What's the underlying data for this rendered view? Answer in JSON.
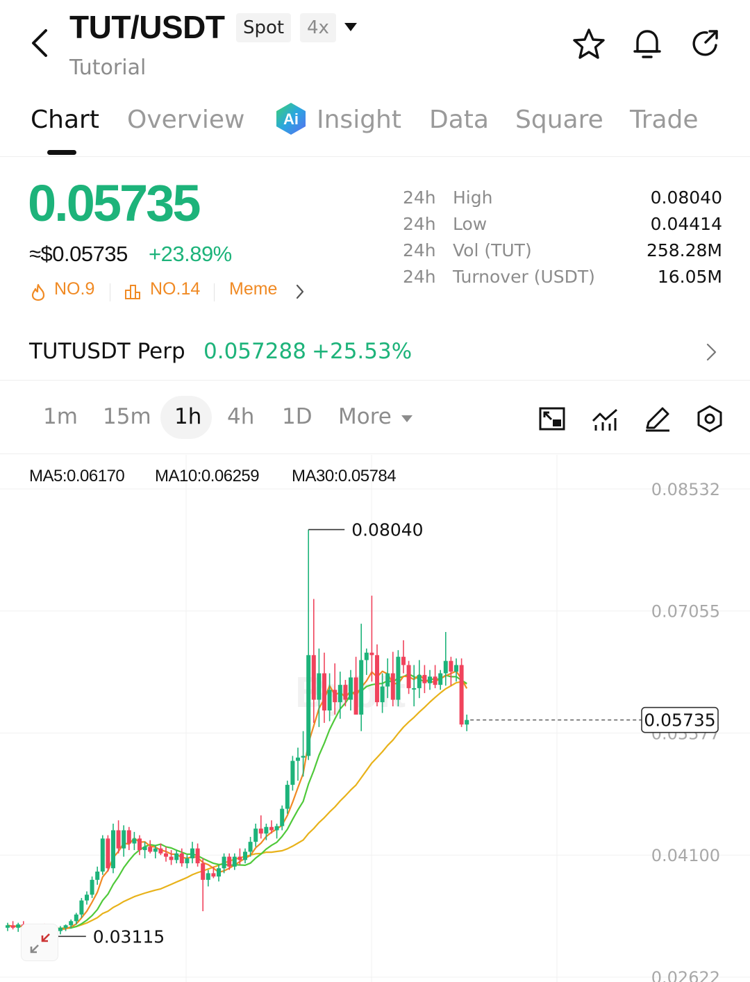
{
  "header": {
    "pair": "TUT/USDT",
    "market_type": "Spot",
    "leverage": "4x",
    "subtitle": "Tutorial",
    "icons": [
      "back-arrow-icon",
      "star-icon",
      "bell-icon",
      "share-icon"
    ]
  },
  "tabs": [
    {
      "label": "Chart",
      "active": true
    },
    {
      "label": "Overview",
      "active": false
    },
    {
      "label": "Insight",
      "active": false,
      "icon": "ai-icon"
    },
    {
      "label": "Data",
      "active": false
    },
    {
      "label": "Square",
      "active": false
    },
    {
      "label": "Trade",
      "active": false
    }
  ],
  "price": {
    "last": "0.05735",
    "fiat": "≈$0.05735",
    "change": "+23.89%",
    "ranks": [
      {
        "icon": "flame-icon",
        "label": "NO.9"
      },
      {
        "icon": "ranking-icon",
        "label": "NO.14"
      }
    ],
    "tag": "Meme",
    "color_up": "#1db37a",
    "color_rank": "#f08a24"
  },
  "stats": [
    {
      "period": "24h",
      "label": "High",
      "value": "0.08040"
    },
    {
      "period": "24h",
      "label": "Low",
      "value": "0.04414"
    },
    {
      "period": "24h",
      "label": "Vol (TUT)",
      "value": "258.28M"
    },
    {
      "period": "24h",
      "label": "Turnover (USDT)",
      "value": "16.05M"
    }
  ],
  "perp": {
    "name": "TUTUSDT Perp",
    "price": "0.057288",
    "change": "+25.53%"
  },
  "intervals": [
    {
      "label": "1m",
      "active": false
    },
    {
      "label": "15m",
      "active": false
    },
    {
      "label": "1h",
      "active": true
    },
    {
      "label": "4h",
      "active": false
    },
    {
      "label": "1D",
      "active": false
    },
    {
      "label": "More",
      "active": false
    }
  ],
  "tools": [
    "fullscreen-icon",
    "indicator-icon",
    "draw-icon",
    "settings-icon"
  ],
  "chart": {
    "ma": [
      {
        "label": "MA5:0.06170",
        "color": "#f08a24"
      },
      {
        "label": "MA10:0.06259",
        "color": "#4fc93a"
      },
      {
        "label": "MA30:0.05784",
        "color": "#e8b21a"
      }
    ],
    "y_ticks": [
      "0.08532",
      "0.07055",
      "0.05577",
      "0.04100",
      "0.02622"
    ],
    "high_label": "0.08040",
    "low_label": "0.03115",
    "current_label": "0.05735",
    "color_up": "#1db37a",
    "color_down": "#f0435c"
  },
  "chart_data": {
    "type": "candlestick",
    "interval": "1h",
    "ylim": [
      0.02622,
      0.08532
    ],
    "y_ticks": [
      0.08532,
      0.07055,
      0.05577,
      0.041,
      0.02622
    ],
    "high": 0.0804,
    "low": 0.03115,
    "last": 0.05735,
    "ma_last": {
      "MA5": 0.0617,
      "MA10": 0.06259,
      "MA30": 0.05784
    },
    "candles": [
      {
        "o": 0.0322,
        "h": 0.0328,
        "l": 0.0318,
        "c": 0.0325
      },
      {
        "o": 0.0325,
        "h": 0.033,
        "l": 0.032,
        "c": 0.0322
      },
      {
        "o": 0.0322,
        "h": 0.0328,
        "l": 0.0317,
        "c": 0.0326
      },
      {
        "o": 0.0326,
        "h": 0.033,
        "l": 0.0318,
        "c": 0.032
      },
      {
        "o": 0.032,
        "h": 0.0325,
        "l": 0.0314,
        "c": 0.0322
      },
      {
        "o": 0.0322,
        "h": 0.0326,
        "l": 0.0318,
        "c": 0.0319
      },
      {
        "o": 0.0319,
        "h": 0.0324,
        "l": 0.0312,
        "c": 0.0323
      },
      {
        "o": 0.0323,
        "h": 0.0327,
        "l": 0.0317,
        "c": 0.0318
      },
      {
        "o": 0.0318,
        "h": 0.0322,
        "l": 0.03115,
        "c": 0.032
      },
      {
        "o": 0.032,
        "h": 0.0325,
        "l": 0.0316,
        "c": 0.0318
      },
      {
        "o": 0.0318,
        "h": 0.0324,
        "l": 0.0314,
        "c": 0.0322
      },
      {
        "o": 0.0322,
        "h": 0.0326,
        "l": 0.0318,
        "c": 0.0325
      },
      {
        "o": 0.0325,
        "h": 0.0332,
        "l": 0.0321,
        "c": 0.033
      },
      {
        "o": 0.033,
        "h": 0.034,
        "l": 0.0326,
        "c": 0.0338
      },
      {
        "o": 0.0338,
        "h": 0.0358,
        "l": 0.0334,
        "c": 0.0355
      },
      {
        "o": 0.0355,
        "h": 0.0366,
        "l": 0.035,
        "c": 0.0362
      },
      {
        "o": 0.0362,
        "h": 0.0384,
        "l": 0.0358,
        "c": 0.038
      },
      {
        "o": 0.038,
        "h": 0.0396,
        "l": 0.0374,
        "c": 0.039
      },
      {
        "o": 0.039,
        "h": 0.0434,
        "l": 0.0386,
        "c": 0.043
      },
      {
        "o": 0.043,
        "h": 0.0434,
        "l": 0.039,
        "c": 0.0394
      },
      {
        "o": 0.0394,
        "h": 0.0448,
        "l": 0.0388,
        "c": 0.044
      },
      {
        "o": 0.044,
        "h": 0.0452,
        "l": 0.0412,
        "c": 0.0418
      },
      {
        "o": 0.0418,
        "h": 0.0446,
        "l": 0.0408,
        "c": 0.044
      },
      {
        "o": 0.044,
        "h": 0.0444,
        "l": 0.0416,
        "c": 0.0424
      },
      {
        "o": 0.0424,
        "h": 0.0438,
        "l": 0.0416,
        "c": 0.043
      },
      {
        "o": 0.043,
        "h": 0.0434,
        "l": 0.041,
        "c": 0.0416
      },
      {
        "o": 0.0416,
        "h": 0.0426,
        "l": 0.0406,
        "c": 0.042
      },
      {
        "o": 0.042,
        "h": 0.0428,
        "l": 0.0412,
        "c": 0.0414
      },
      {
        "o": 0.0414,
        "h": 0.0422,
        "l": 0.0406,
        "c": 0.0418
      },
      {
        "o": 0.0418,
        "h": 0.0424,
        "l": 0.041,
        "c": 0.0412
      },
      {
        "o": 0.0412,
        "h": 0.042,
        "l": 0.0402,
        "c": 0.0408
      },
      {
        "o": 0.0408,
        "h": 0.0416,
        "l": 0.0398,
        "c": 0.0404
      },
      {
        "o": 0.0404,
        "h": 0.0416,
        "l": 0.04,
        "c": 0.0412
      },
      {
        "o": 0.0412,
        "h": 0.0418,
        "l": 0.0396,
        "c": 0.04
      },
      {
        "o": 0.04,
        "h": 0.041,
        "l": 0.0394,
        "c": 0.0406
      },
      {
        "o": 0.0406,
        "h": 0.0426,
        "l": 0.04,
        "c": 0.0418
      },
      {
        "o": 0.0418,
        "h": 0.0424,
        "l": 0.0396,
        "c": 0.04
      },
      {
        "o": 0.04,
        "h": 0.0406,
        "l": 0.0342,
        "c": 0.038
      },
      {
        "o": 0.038,
        "h": 0.0392,
        "l": 0.0372,
        "c": 0.0388
      },
      {
        "o": 0.0388,
        "h": 0.0396,
        "l": 0.0382,
        "c": 0.0384
      },
      {
        "o": 0.0384,
        "h": 0.0398,
        "l": 0.0378,
        "c": 0.0394
      },
      {
        "o": 0.0394,
        "h": 0.0412,
        "l": 0.0388,
        "c": 0.0408
      },
      {
        "o": 0.0408,
        "h": 0.0412,
        "l": 0.0392,
        "c": 0.0396
      },
      {
        "o": 0.0396,
        "h": 0.0412,
        "l": 0.0392,
        "c": 0.0408
      },
      {
        "o": 0.0408,
        "h": 0.0418,
        "l": 0.0398,
        "c": 0.0404
      },
      {
        "o": 0.0404,
        "h": 0.0418,
        "l": 0.04,
        "c": 0.0414
      },
      {
        "o": 0.0414,
        "h": 0.0432,
        "l": 0.0408,
        "c": 0.0426
      },
      {
        "o": 0.0426,
        "h": 0.0448,
        "l": 0.042,
        "c": 0.0442
      },
      {
        "o": 0.0442,
        "h": 0.0458,
        "l": 0.043,
        "c": 0.0436
      },
      {
        "o": 0.0436,
        "h": 0.0448,
        "l": 0.0428,
        "c": 0.0444
      },
      {
        "o": 0.0444,
        "h": 0.0452,
        "l": 0.0436,
        "c": 0.044
      },
      {
        "o": 0.044,
        "h": 0.0448,
        "l": 0.043,
        "c": 0.0445
      },
      {
        "o": 0.0445,
        "h": 0.047,
        "l": 0.044,
        "c": 0.0466
      },
      {
        "o": 0.0466,
        "h": 0.05,
        "l": 0.046,
        "c": 0.0495
      },
      {
        "o": 0.0495,
        "h": 0.053,
        "l": 0.0488,
        "c": 0.0524
      },
      {
        "o": 0.0524,
        "h": 0.054,
        "l": 0.05,
        "c": 0.0528
      },
      {
        "o": 0.0528,
        "h": 0.056,
        "l": 0.0505,
        "c": 0.053
      },
      {
        "o": 0.053,
        "h": 0.0804,
        "l": 0.0525,
        "c": 0.0652
      },
      {
        "o": 0.0652,
        "h": 0.072,
        "l": 0.057,
        "c": 0.0598
      },
      {
        "o": 0.0598,
        "h": 0.066,
        "l": 0.0565,
        "c": 0.063
      },
      {
        "o": 0.063,
        "h": 0.0655,
        "l": 0.057,
        "c": 0.0585
      },
      {
        "o": 0.0585,
        "h": 0.063,
        "l": 0.0572,
        "c": 0.061
      },
      {
        "o": 0.061,
        "h": 0.0642,
        "l": 0.058,
        "c": 0.0595
      },
      {
        "o": 0.0595,
        "h": 0.0632,
        "l": 0.0575,
        "c": 0.0616
      },
      {
        "o": 0.0616,
        "h": 0.0622,
        "l": 0.059,
        "c": 0.0598
      },
      {
        "o": 0.0598,
        "h": 0.0634,
        "l": 0.0585,
        "c": 0.0625
      },
      {
        "o": 0.0625,
        "h": 0.065,
        "l": 0.058,
        "c": 0.058
      },
      {
        "o": 0.058,
        "h": 0.069,
        "l": 0.056,
        "c": 0.0646
      },
      {
        "o": 0.0646,
        "h": 0.066,
        "l": 0.0628,
        "c": 0.0655
      },
      {
        "o": 0.0655,
        "h": 0.0724,
        "l": 0.062,
        "c": 0.0652
      },
      {
        "o": 0.0652,
        "h": 0.0665,
        "l": 0.059,
        "c": 0.0595
      },
      {
        "o": 0.0595,
        "h": 0.063,
        "l": 0.0582,
        "c": 0.0614
      },
      {
        "o": 0.0614,
        "h": 0.0648,
        "l": 0.06,
        "c": 0.063
      },
      {
        "o": 0.063,
        "h": 0.0656,
        "l": 0.059,
        "c": 0.0598
      },
      {
        "o": 0.0598,
        "h": 0.0658,
        "l": 0.059,
        "c": 0.065
      },
      {
        "o": 0.065,
        "h": 0.067,
        "l": 0.063,
        "c": 0.064
      },
      {
        "o": 0.064,
        "h": 0.0645,
        "l": 0.0605,
        "c": 0.0612
      },
      {
        "o": 0.0612,
        "h": 0.064,
        "l": 0.059,
        "c": 0.0612
      },
      {
        "o": 0.0612,
        "h": 0.0646,
        "l": 0.06,
        "c": 0.0628
      },
      {
        "o": 0.0628,
        "h": 0.064,
        "l": 0.0606,
        "c": 0.0618
      },
      {
        "o": 0.0618,
        "h": 0.0634,
        "l": 0.061,
        "c": 0.0626
      },
      {
        "o": 0.0626,
        "h": 0.064,
        "l": 0.0612,
        "c": 0.0616
      },
      {
        "o": 0.0616,
        "h": 0.0634,
        "l": 0.061,
        "c": 0.063
      },
      {
        "o": 0.063,
        "h": 0.068,
        "l": 0.0615,
        "c": 0.0645
      },
      {
        "o": 0.0645,
        "h": 0.065,
        "l": 0.0615,
        "c": 0.0632
      },
      {
        "o": 0.0632,
        "h": 0.0648,
        "l": 0.062,
        "c": 0.064
      },
      {
        "o": 0.064,
        "h": 0.0648,
        "l": 0.0565,
        "c": 0.0568
      },
      {
        "o": 0.0568,
        "h": 0.058,
        "l": 0.056,
        "c": 0.05735
      }
    ]
  }
}
